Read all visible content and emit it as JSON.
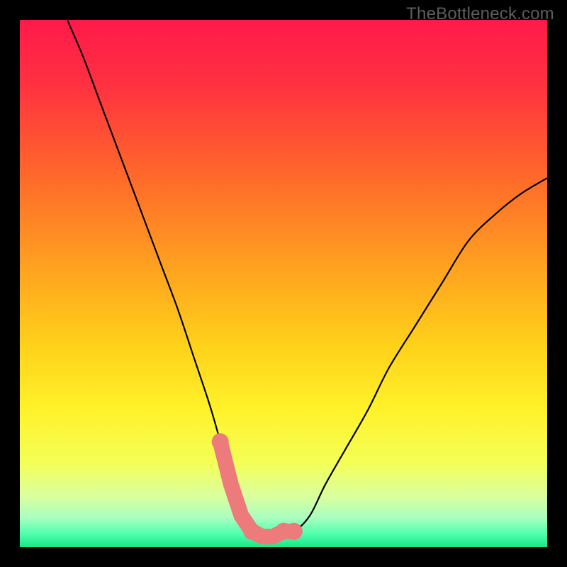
{
  "watermark": "TheBottleneck.com",
  "chart_data": {
    "type": "line",
    "title": "",
    "xlabel": "",
    "ylabel": "",
    "xlim": [
      0,
      100
    ],
    "ylim": [
      0,
      100
    ],
    "grid": false,
    "legend": false,
    "description": "Bottleneck deviation curve on a red-to-green gradient. Two branches descend from higher bottleneck values at the extremes toward a flat minimum near zero bottleneck around x≈40–50. Highlighted salmon markers indicate the recommended/near-optimal region at the trough.",
    "series": [
      {
        "name": "bottleneck-curve",
        "x": [
          9,
          12,
          15,
          18,
          21,
          24,
          27,
          30,
          33,
          36,
          38,
          40,
          42,
          44,
          46,
          48,
          50,
          52,
          55,
          58,
          62,
          66,
          70,
          75,
          80,
          85,
          90,
          95,
          100
        ],
        "values": [
          100,
          93,
          85,
          77,
          69,
          61,
          53,
          45,
          36,
          27,
          20,
          12,
          6,
          3,
          2,
          2,
          3,
          3,
          6,
          12,
          19,
          26,
          34,
          42,
          50,
          58,
          63,
          67,
          70
        ]
      }
    ],
    "highlight_segments": [
      {
        "label": "optimal-left",
        "x_start": 38,
        "x_end": 44
      },
      {
        "label": "optimal-flat",
        "x_start": 44,
        "x_end": 50
      },
      {
        "label": "optimal-right",
        "x_start": 50,
        "x_end": 52
      }
    ],
    "gradient_stops": [
      {
        "offset": 0.0,
        "color": "#ff1a4a"
      },
      {
        "offset": 0.12,
        "color": "#ff3040"
      },
      {
        "offset": 0.3,
        "color": "#ff6a2a"
      },
      {
        "offset": 0.48,
        "color": "#ffa51f"
      },
      {
        "offset": 0.62,
        "color": "#ffd21a"
      },
      {
        "offset": 0.74,
        "color": "#fff22a"
      },
      {
        "offset": 0.84,
        "color": "#f4ff57"
      },
      {
        "offset": 0.905,
        "color": "#d9ffa0"
      },
      {
        "offset": 0.945,
        "color": "#a8ffc0"
      },
      {
        "offset": 0.975,
        "color": "#4fffad"
      },
      {
        "offset": 1.0,
        "color": "#17e886"
      }
    ]
  }
}
